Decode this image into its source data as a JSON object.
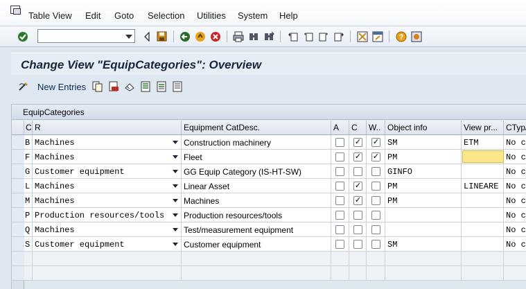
{
  "menu": {
    "items": [
      "Table View",
      "Edit",
      "Goto",
      "Selection",
      "Utilities",
      "System",
      "Help"
    ],
    "underlines": [
      "T",
      "E",
      "G",
      "l",
      "t",
      "y",
      "H"
    ]
  },
  "toolbar": {
    "command_value": "",
    "icons": [
      "enter-icon",
      "back-icon",
      "save-icon",
      "back-nav-icon",
      "exit-icon",
      "cancel-icon",
      "print-icon",
      "find-icon",
      "find-next-icon",
      "first-page-icon",
      "previous-page-icon",
      "next-page-icon",
      "last-page-icon",
      "create-session-icon",
      "shortcut-icon",
      "help-icon",
      "layout-icon"
    ]
  },
  "title": "Change View \"EquipCategories\": Overview",
  "app_toolbar": {
    "new_entries_label": "New Entries"
  },
  "table": {
    "title": "EquipCategories",
    "columns": [
      "C",
      "R",
      "Equipment CatDesc.",
      "A",
      "C",
      "W..",
      "Object info",
      "View pr...",
      "CTyp/"
    ],
    "rows": [
      {
        "c": "B",
        "r": "Machines",
        "desc": "Construction machinery",
        "a": false,
        "c2": true,
        "w": true,
        "obj": "SM",
        "view": "ETM",
        "ctyp": "No ch"
      },
      {
        "c": "F",
        "r": "Machines",
        "desc": "Fleet",
        "a": false,
        "c2": true,
        "w": true,
        "obj": "PM",
        "view": "",
        "ctyp": "No ch"
      },
      {
        "c": "G",
        "r": "Customer equipment",
        "desc": "GG Equip Category (IS-HT-SW)",
        "a": false,
        "c2": false,
        "w": false,
        "obj": "GINFO",
        "view": "",
        "ctyp": "No ch"
      },
      {
        "c": "L",
        "r": "Machines",
        "desc": "Linear Asset",
        "a": false,
        "c2": true,
        "w": false,
        "obj": "PM",
        "view": "LINEARE",
        "ctyp": "No ch"
      },
      {
        "c": "M",
        "r": "Machines",
        "desc": "Machines",
        "a": false,
        "c2": true,
        "w": false,
        "obj": "PM",
        "view": "",
        "ctyp": "No ch"
      },
      {
        "c": "P",
        "r": "Production resources/tools",
        "desc": "Production resources/tools",
        "a": false,
        "c2": false,
        "w": false,
        "obj": "",
        "view": "",
        "ctyp": "No ch"
      },
      {
        "c": "Q",
        "r": "Machines",
        "desc": "Test/measurement equipment",
        "a": false,
        "c2": false,
        "w": false,
        "obj": "",
        "view": "",
        "ctyp": "No ch"
      },
      {
        "c": "S",
        "r": "Customer equipment",
        "desc": "Customer equipment",
        "a": false,
        "c2": false,
        "w": false,
        "obj": "SM",
        "view": "",
        "ctyp": "No ch"
      }
    ],
    "check_mark": "✓"
  },
  "colors": {
    "background": "#dfe7f0",
    "focus_field": "#fbe68a",
    "title_text": "#152739"
  }
}
